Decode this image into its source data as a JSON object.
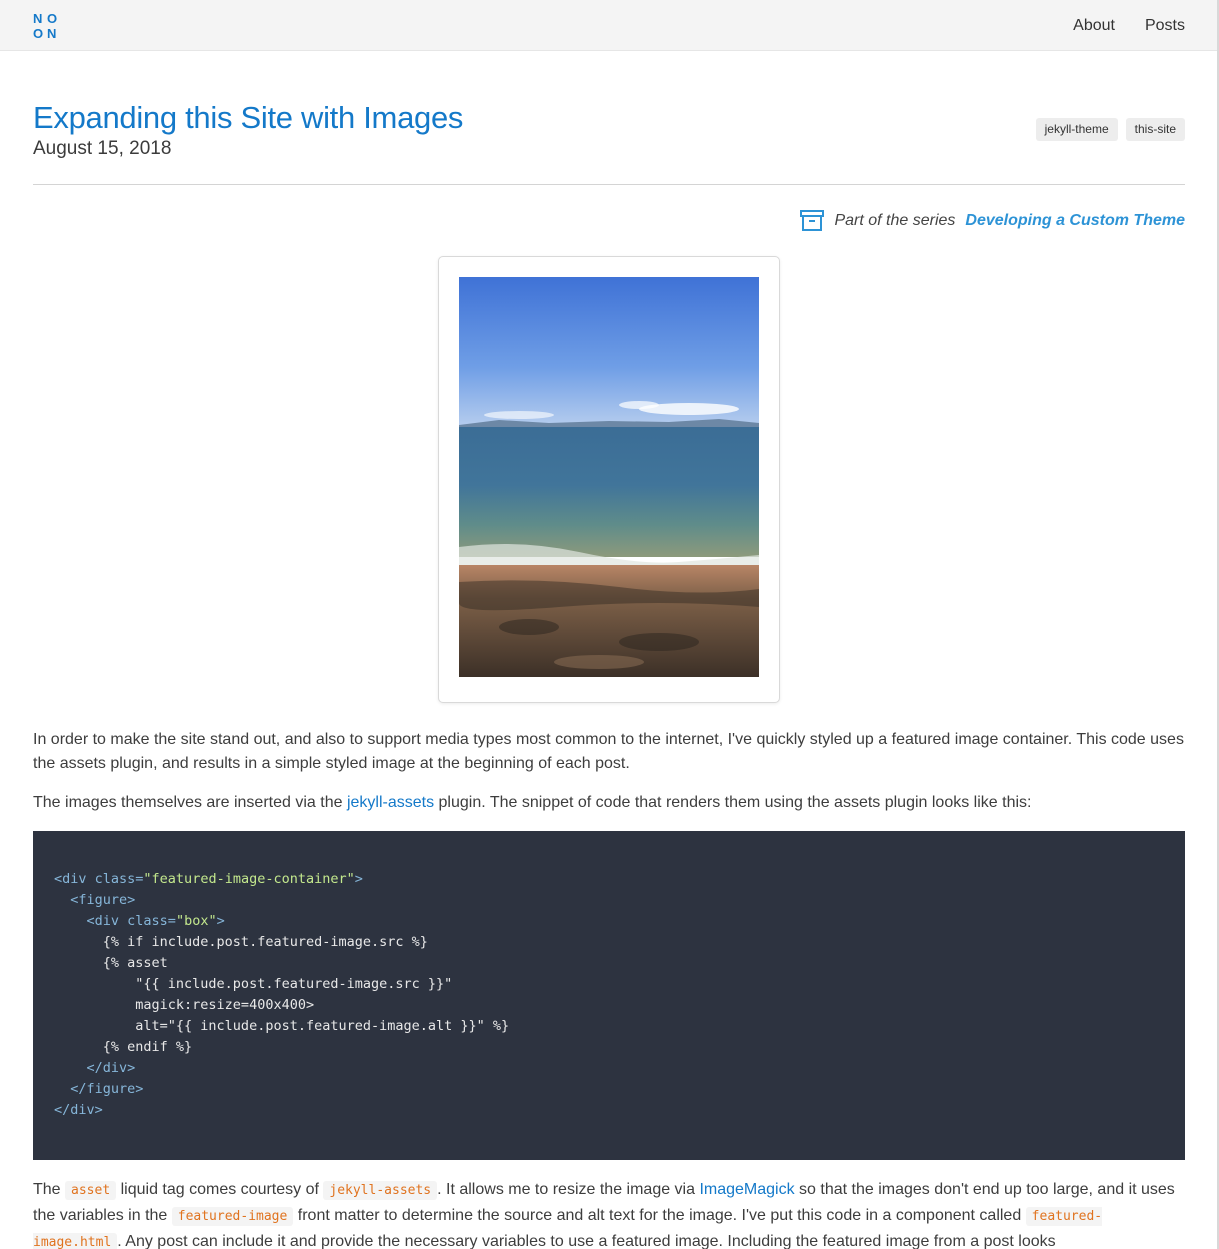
{
  "header": {
    "logo_letters": [
      "N",
      "O",
      "O",
      "N"
    ],
    "nav": [
      {
        "label": "About"
      },
      {
        "label": "Posts"
      }
    ]
  },
  "post": {
    "title": "Expanding this Site with Images",
    "date": "August 15, 2018",
    "tags": [
      "jekyll-theme",
      "this-site"
    ],
    "series_prefix": "Part of the series",
    "series_link": "Developing a Custom Theme"
  },
  "content": {
    "p1": "In order to make the site stand out, and also to support media types most common to the internet, I've quickly styled up a featured image container. This code uses the assets plugin, and results in a simple styled image at the beginning of each post.",
    "p2_before": "The images themselves are inserted via the ",
    "p2_link": "jekyll-assets",
    "p2_after": " plugin. The snippet of code that renders them using the assets plugin looks like this:",
    "code_lines": [
      "<div class=\"featured-image-container\">",
      "  <figure>",
      "    <div class=\"box\">",
      "      {% if include.post.featured-image.src %}",
      "      {% asset",
      "          \"{{ include.post.featured-image.src }}\"",
      "          magick:resize=400x400>",
      "          alt=\"{{ include.post.featured-image.alt }}\" %}",
      "      {% endif %}",
      "    </div>",
      "  </figure>",
      "</div>"
    ],
    "p3_t1": "The ",
    "p3_code1": "asset",
    "p3_t2": " liquid tag comes courtesy of ",
    "p3_code2": "jekyll-assets",
    "p3_t3": ". It allows me to resize the image via ",
    "p3_link": "ImageMagick",
    "p3_t4": " so that the images don't end up too large, and it uses the variables in the ",
    "p3_code3": "featured-image",
    "p3_t5": " front matter to determine the source and alt text for the image. I've put this code in a component called ",
    "p3_code4": "featured-image.html",
    "p3_t6": ". Any post can include it and provide the necessary variables to use a featured image. Including the featured image from a post looks"
  },
  "colors": {
    "link": "#1479c9",
    "accent": "#2d93d6",
    "code_bg": "#2d3340",
    "inline_code": "#e0731f"
  }
}
